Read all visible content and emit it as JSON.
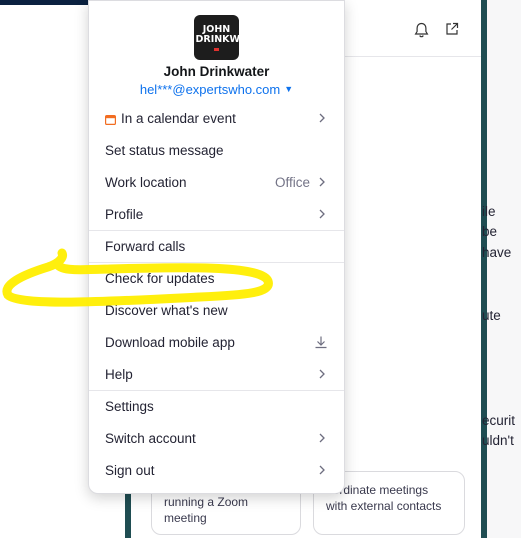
{
  "background": {
    "text_fragments": [
      "ile",
      "be",
      "have",
      "ute",
      "ecurit",
      "uldn't"
    ],
    "cards": [
      {
        "text": "running a Zoom meeting"
      },
      {
        "text": "oordinate meetings with external contacts"
      }
    ]
  },
  "profile": {
    "avatar_text": "JOHN DRINKWATER",
    "name": "John Drinkwater",
    "email": "hel***@expertswho.com"
  },
  "menu": {
    "items": [
      {
        "label": "In a calendar event",
        "icon": "calendar-icon",
        "chevron": true
      },
      {
        "label": "Set status message"
      },
      {
        "label": "Work location",
        "value": "Office",
        "chevron": true
      },
      {
        "label": "Profile",
        "chevron": true
      },
      {
        "label": "Forward calls"
      },
      {
        "label": "Check for updates"
      },
      {
        "label": "Discover what's new"
      },
      {
        "label": "Download mobile app",
        "icon": "download-icon"
      },
      {
        "label": "Help",
        "chevron": true
      },
      {
        "label": "Settings"
      },
      {
        "label": "Switch account",
        "chevron": true
      },
      {
        "label": "Sign out",
        "chevron": true
      }
    ]
  },
  "colors": {
    "accent": "#0e72ed",
    "highlight": "#ffee00",
    "panel_border": "#1f4d52"
  }
}
